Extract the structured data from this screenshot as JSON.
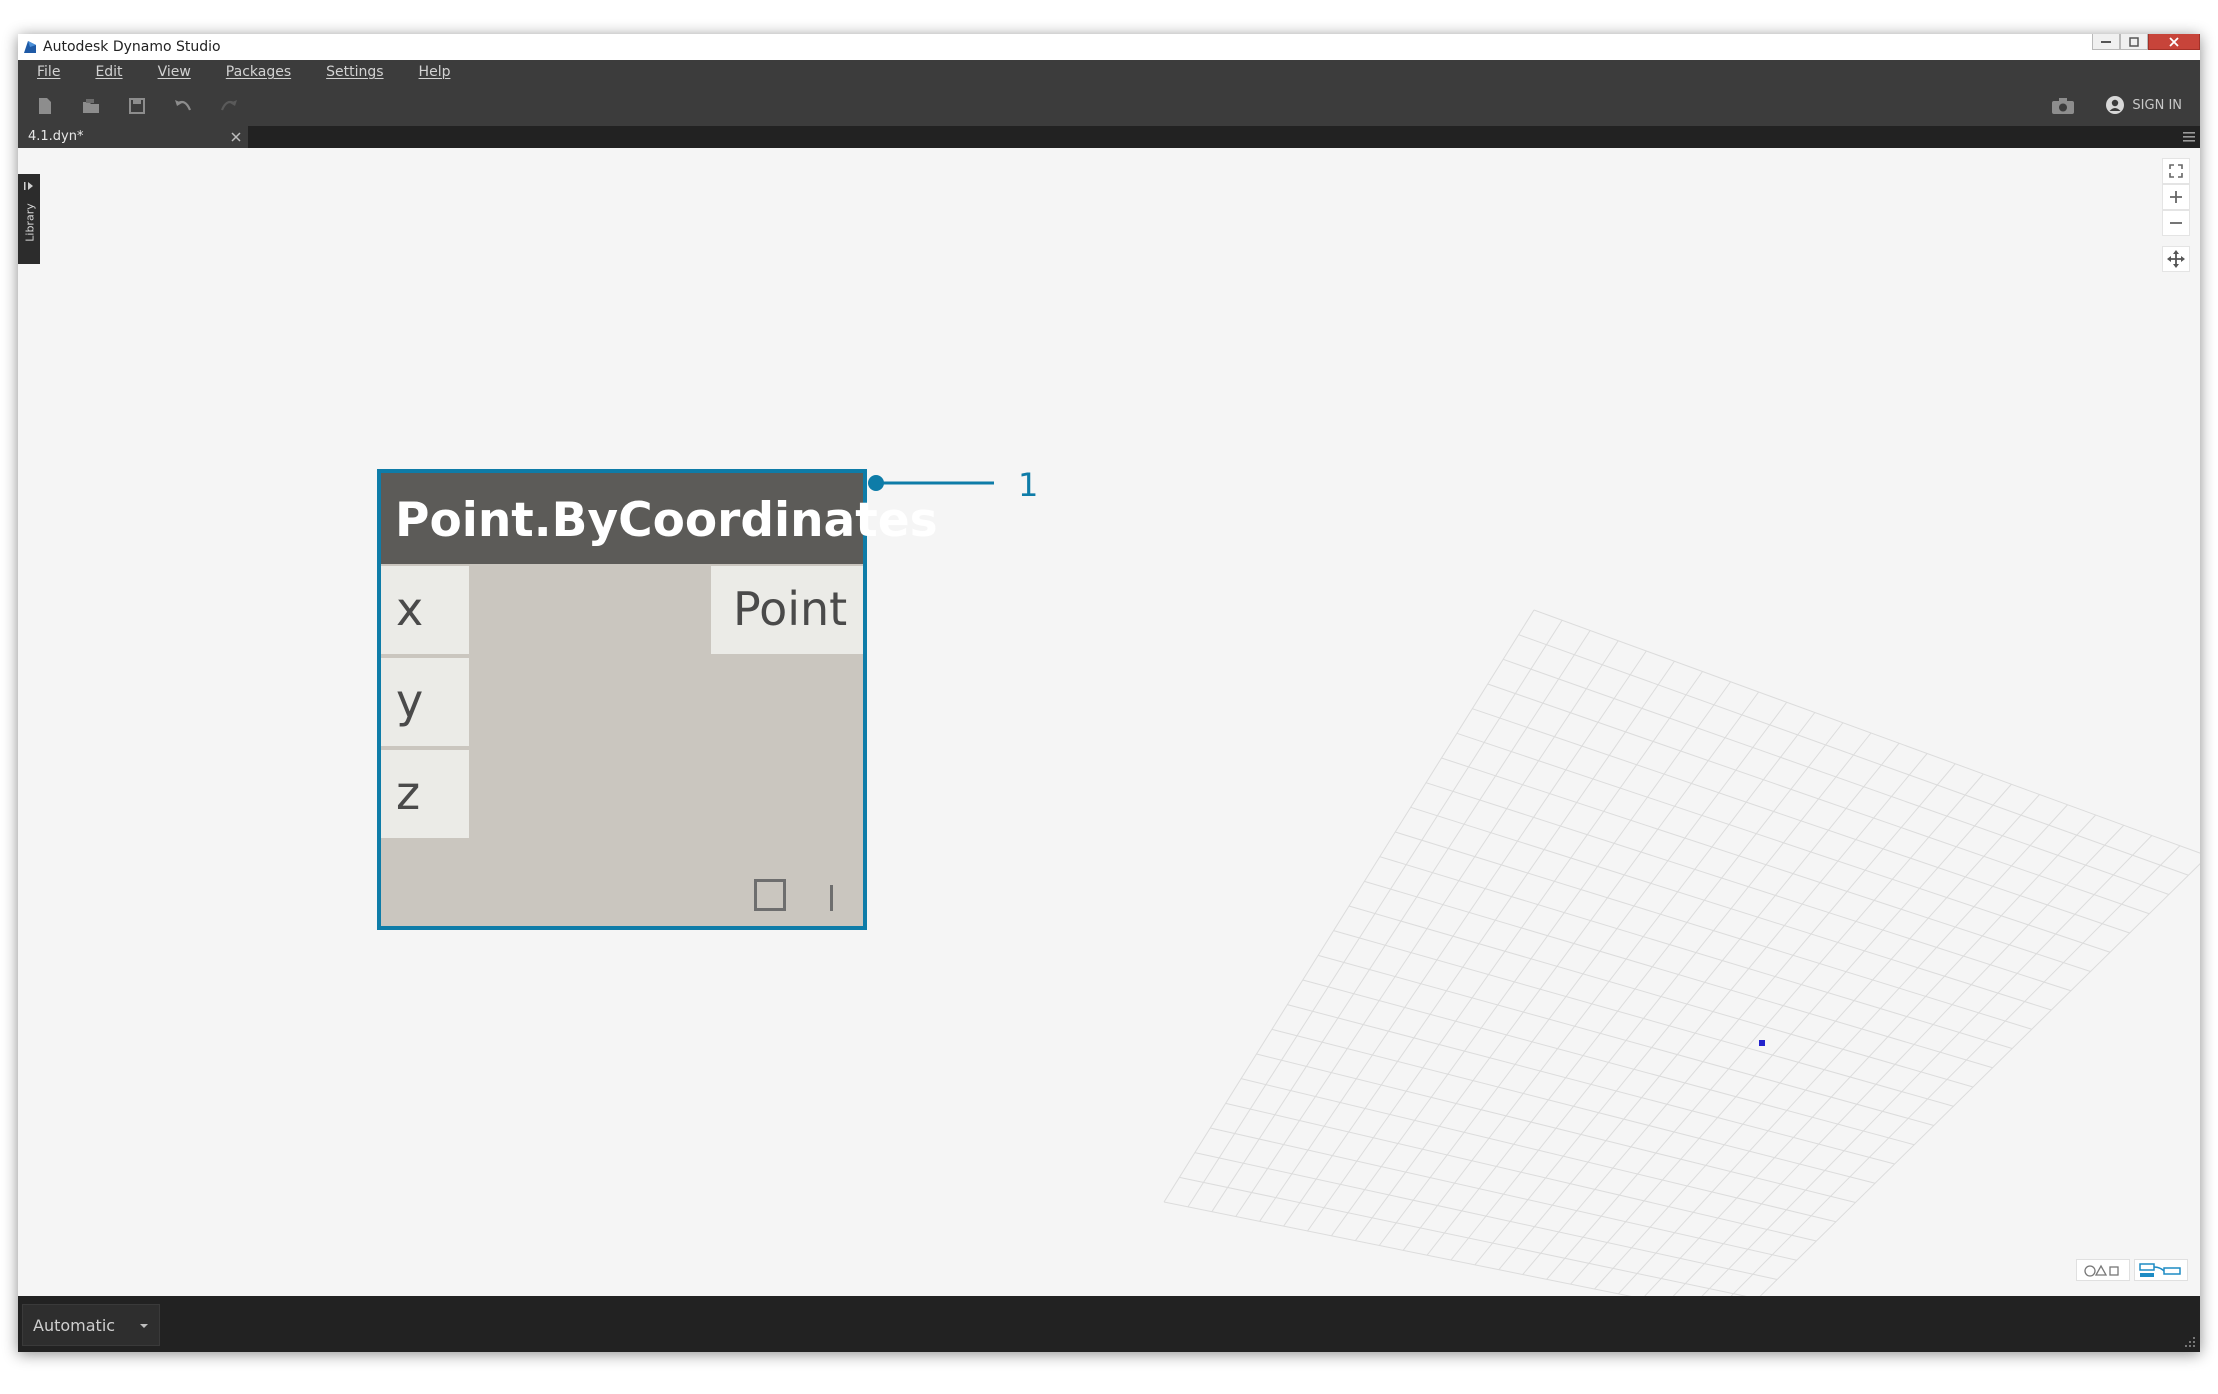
{
  "window": {
    "title": "Autodesk Dynamo Studio"
  },
  "menu": [
    "File",
    "Edit",
    "View",
    "Packages",
    "Settings",
    "Help"
  ],
  "toolbar": {
    "icons": [
      "new-file-icon",
      "open-file-icon",
      "save-icon",
      "undo-icon",
      "redo-icon"
    ],
    "sign_in_label": "SIGN IN"
  },
  "tab": {
    "label": "4.1.dyn*"
  },
  "library": {
    "label": "Library"
  },
  "node": {
    "title": "Point.ByCoordinates",
    "inputs": [
      "x",
      "y",
      "z"
    ],
    "output": "Point"
  },
  "callout": {
    "number": "1"
  },
  "status": {
    "run_mode": "Automatic"
  },
  "colors": {
    "accent": "#0e7ca8",
    "node_header": "#5c5b58",
    "node_body": "#cac6bf",
    "chrome": "#3c3c3c"
  }
}
